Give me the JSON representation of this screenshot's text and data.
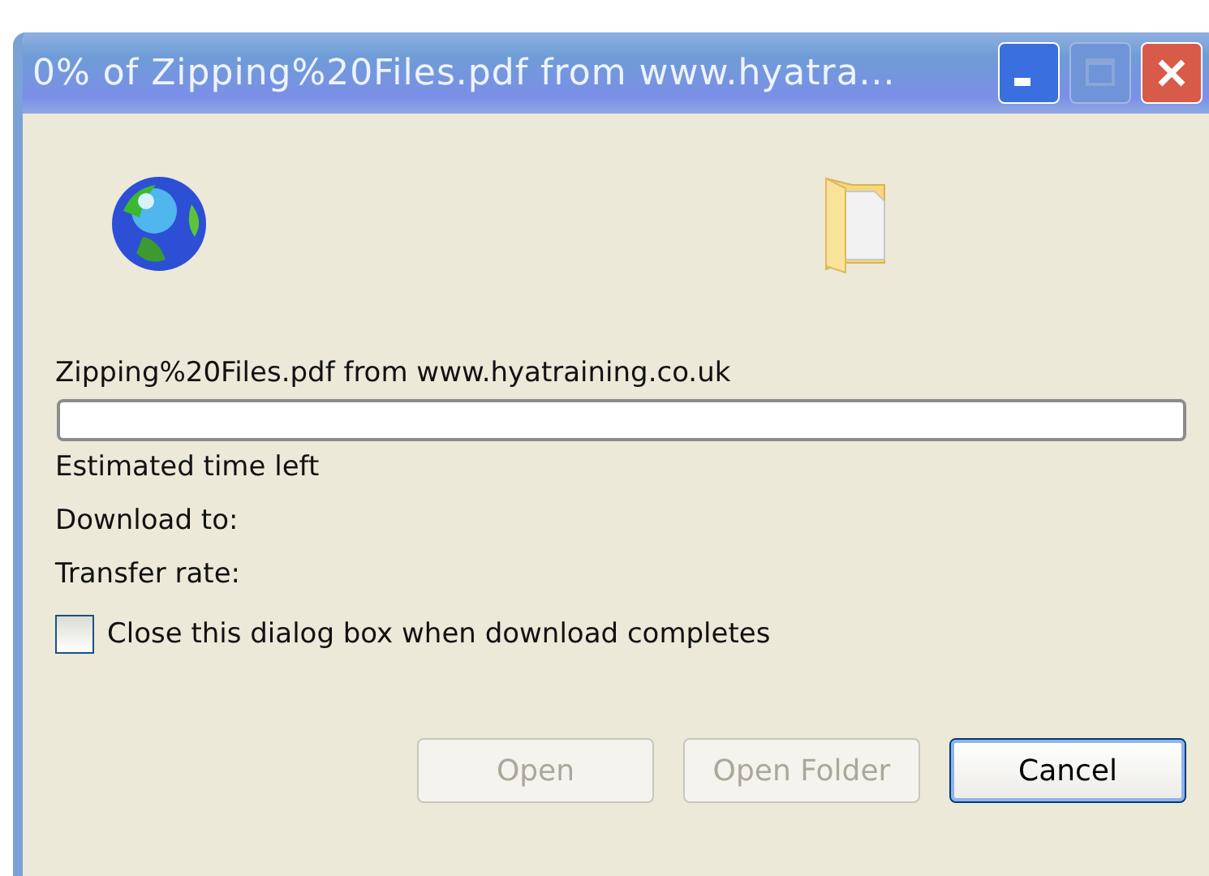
{
  "window": {
    "title": "0% of Zipping%20Files.pdf from www.hyatra..."
  },
  "source": "Zipping%20Files.pdf from www.hyatraining.co.uk",
  "progress": {
    "level": 0
  },
  "fields": [
    "Estimated time left",
    "Download to:",
    "Transfer rate:"
  ],
  "close_when_done": {
    "label": "Close this dialog box when download completes",
    "checked": false
  },
  "buttons": [
    {
      "label": "Open",
      "disabled": true,
      "default": false
    },
    {
      "label": "Open Folder",
      "disabled": true,
      "default": false
    },
    {
      "label": "Cancel",
      "disabled": false,
      "default": true
    }
  ]
}
